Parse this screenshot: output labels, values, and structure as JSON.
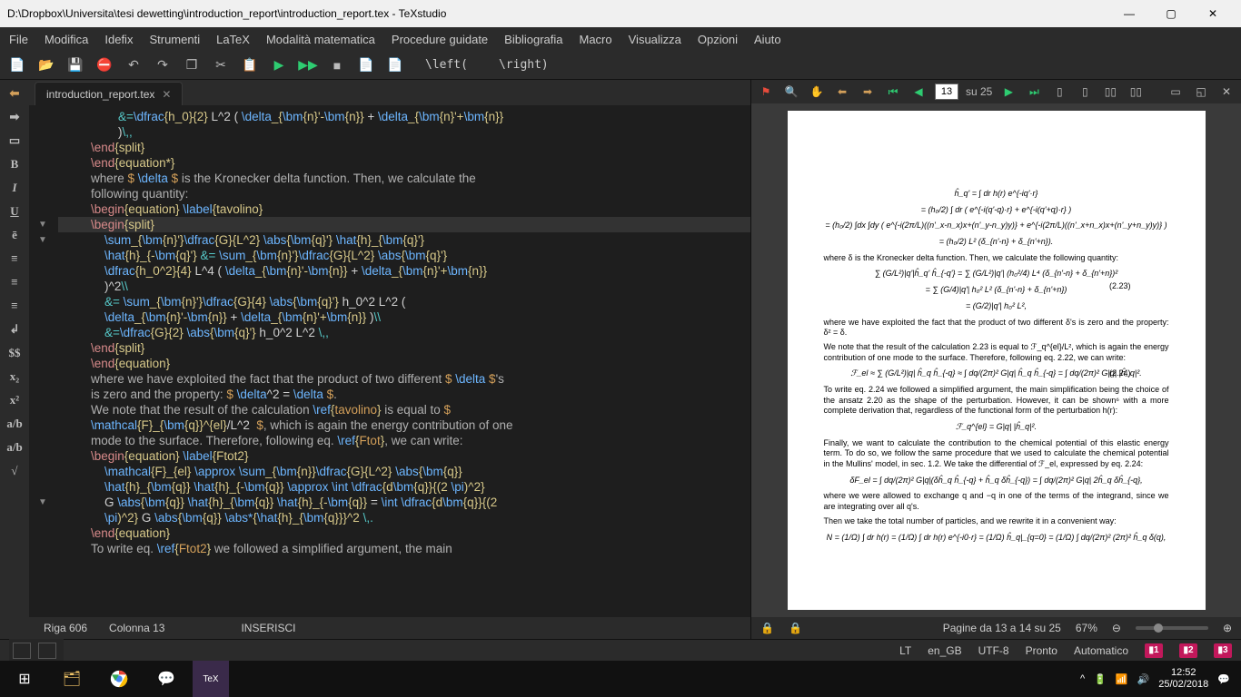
{
  "titlebar": {
    "title": "D:\\Dropbox\\Universita\\tesi dewetting\\introduction_report\\introduction_report.tex - TeXstudio"
  },
  "menubar": [
    "File",
    "Modifica",
    "Idefix",
    "Strumenti",
    "LaTeX",
    "Modalità matematica",
    "Procedure guidate",
    "Bibliografia",
    "Macro",
    "Visualizza",
    "Opzioni",
    "Aiuto"
  ],
  "brackets": {
    "left": "\\left(",
    "right": "\\right)"
  },
  "tab": {
    "name": "introduction_report.tex"
  },
  "editor": {
    "lines": [
      [
        [
          "c-cyan",
          "        &="
        ],
        [
          "c-blue",
          "\\dfrac"
        ],
        [
          "c-yellow",
          "{h_0}{2}"
        ],
        [
          "c-white",
          " L^2 ( "
        ],
        [
          "c-blue",
          "\\delta"
        ],
        [
          "c-yellow",
          "_{"
        ],
        [
          "c-blue",
          "\\bm"
        ],
        [
          "c-yellow",
          "{n}'-"
        ],
        [
          "c-blue",
          "\\bm"
        ],
        [
          "c-yellow",
          "{n}}"
        ],
        [
          "c-white",
          " + "
        ],
        [
          "c-blue",
          "\\delta"
        ],
        [
          "c-yellow",
          "_{"
        ],
        [
          "c-blue",
          "\\bm"
        ],
        [
          "c-yellow",
          "{n}'+"
        ],
        [
          "c-blue",
          "\\bm"
        ],
        [
          "c-yellow",
          "{n}}"
        ]
      ],
      [
        [
          "c-white",
          "        )"
        ],
        [
          "c-cyan",
          "\\,,"
        ]
      ],
      [
        [
          "c-redish",
          "\\end"
        ],
        [
          "c-yellow",
          "{split}"
        ]
      ],
      [
        [
          "c-redish",
          "\\end"
        ],
        [
          "c-yellow",
          "{equation*}"
        ]
      ],
      [
        [
          "c-plain",
          "where "
        ],
        [
          "c-orange",
          "$ "
        ],
        [
          "c-blue",
          "\\delta"
        ],
        [
          "c-orange",
          " $"
        ],
        [
          "c-plain",
          " is the Kronecker delta function. Then, we calculate the"
        ]
      ],
      [
        [
          "c-plain",
          "following quantity:"
        ]
      ],
      [
        [
          "c-plain",
          ""
        ]
      ],
      [
        [
          "c-redish",
          "\\begin"
        ],
        [
          "c-yellow",
          "{equation}"
        ],
        [
          "c-white",
          " "
        ],
        [
          "c-blue",
          "\\label"
        ],
        [
          "c-yellow",
          "{tavolino}"
        ]
      ],
      [
        [
          "c-redish",
          "\\begin"
        ],
        [
          "c-yellow",
          "{split}"
        ]
      ],
      [
        [
          "c-white",
          "    "
        ],
        [
          "c-blue",
          "\\sum"
        ],
        [
          "c-yellow",
          "_{"
        ],
        [
          "c-blue",
          "\\bm"
        ],
        [
          "c-yellow",
          "{n}'}"
        ],
        [
          "c-blue",
          "\\dfrac"
        ],
        [
          "c-yellow",
          "{G}{L^2}"
        ],
        [
          "c-white",
          " "
        ],
        [
          "c-blue",
          "\\abs"
        ],
        [
          "c-yellow",
          "{"
        ],
        [
          "c-blue",
          "\\bm"
        ],
        [
          "c-yellow",
          "{q}'}"
        ],
        [
          "c-white",
          " "
        ],
        [
          "c-blue",
          "\\hat"
        ],
        [
          "c-yellow",
          "{h}_{"
        ],
        [
          "c-blue",
          "\\bm"
        ],
        [
          "c-yellow",
          "{q}'}"
        ]
      ],
      [
        [
          "c-white",
          "    "
        ],
        [
          "c-blue",
          "\\hat"
        ],
        [
          "c-yellow",
          "{h}_{-"
        ],
        [
          "c-blue",
          "\\bm"
        ],
        [
          "c-yellow",
          "{q}'}"
        ],
        [
          "c-cyan",
          " &= "
        ],
        [
          "c-blue",
          "\\sum"
        ],
        [
          "c-yellow",
          "_{"
        ],
        [
          "c-blue",
          "\\bm"
        ],
        [
          "c-yellow",
          "{n}'}"
        ],
        [
          "c-blue",
          "\\dfrac"
        ],
        [
          "c-yellow",
          "{G}{L^2}"
        ],
        [
          "c-white",
          " "
        ],
        [
          "c-blue",
          "\\abs"
        ],
        [
          "c-yellow",
          "{"
        ],
        [
          "c-blue",
          "\\bm"
        ],
        [
          "c-yellow",
          "{q}'}"
        ]
      ],
      [
        [
          "c-white",
          "    "
        ],
        [
          "c-blue",
          "\\dfrac"
        ],
        [
          "c-yellow",
          "{h_0^2}{4}"
        ],
        [
          "c-white",
          " L^4 ( "
        ],
        [
          "c-blue",
          "\\delta"
        ],
        [
          "c-yellow",
          "_{"
        ],
        [
          "c-blue",
          "\\bm"
        ],
        [
          "c-yellow",
          "{n}'-"
        ],
        [
          "c-blue",
          "\\bm"
        ],
        [
          "c-yellow",
          "{n}}"
        ],
        [
          "c-white",
          " + "
        ],
        [
          "c-blue",
          "\\delta"
        ],
        [
          "c-yellow",
          "_{"
        ],
        [
          "c-blue",
          "\\bm"
        ],
        [
          "c-yellow",
          "{n}'+"
        ],
        [
          "c-blue",
          "\\bm"
        ],
        [
          "c-yellow",
          "{n}}"
        ]
      ],
      [
        [
          "c-white",
          "    )^2"
        ],
        [
          "c-cyan",
          "\\\\"
        ]
      ],
      [
        [
          "c-cyan",
          "    &= "
        ],
        [
          "c-blue",
          "\\sum"
        ],
        [
          "c-yellow",
          "_{"
        ],
        [
          "c-blue",
          "\\bm"
        ],
        [
          "c-yellow",
          "{n}'}"
        ],
        [
          "c-blue",
          "\\dfrac"
        ],
        [
          "c-yellow",
          "{G}{4}"
        ],
        [
          "c-white",
          " "
        ],
        [
          "c-blue",
          "\\abs"
        ],
        [
          "c-yellow",
          "{"
        ],
        [
          "c-blue",
          "\\bm"
        ],
        [
          "c-yellow",
          "{q}'}"
        ],
        [
          "c-white",
          " h_0^2 L^2 ("
        ]
      ],
      [
        [
          "c-white",
          "    "
        ],
        [
          "c-blue",
          "\\delta"
        ],
        [
          "c-yellow",
          "_{"
        ],
        [
          "c-blue",
          "\\bm"
        ],
        [
          "c-yellow",
          "{n}'-"
        ],
        [
          "c-blue",
          "\\bm"
        ],
        [
          "c-yellow",
          "{n}}"
        ],
        [
          "c-white",
          " + "
        ],
        [
          "c-blue",
          "\\delta"
        ],
        [
          "c-yellow",
          "_{"
        ],
        [
          "c-blue",
          "\\bm"
        ],
        [
          "c-yellow",
          "{n}'+"
        ],
        [
          "c-blue",
          "\\bm"
        ],
        [
          "c-yellow",
          "{n}}"
        ],
        [
          "c-white",
          " )"
        ],
        [
          "c-cyan",
          "\\\\"
        ]
      ],
      [
        [
          "c-cyan",
          "    &="
        ],
        [
          "c-blue",
          "\\dfrac"
        ],
        [
          "c-yellow",
          "{G}{2}"
        ],
        [
          "c-white",
          " "
        ],
        [
          "c-blue",
          "\\abs"
        ],
        [
          "c-yellow",
          "{"
        ],
        [
          "c-blue",
          "\\bm"
        ],
        [
          "c-yellow",
          "{q}'}"
        ],
        [
          "c-white",
          " h_0^2 L^2 "
        ],
        [
          "c-cyan",
          "\\,,"
        ]
      ],
      [
        [
          "c-redish",
          "\\end"
        ],
        [
          "c-yellow",
          "{split}"
        ]
      ],
      [
        [
          "c-redish",
          "\\end"
        ],
        [
          "c-yellow",
          "{equation}"
        ]
      ],
      [
        [
          "c-plain",
          "where we have exploited the fact that the product of two different "
        ],
        [
          "c-orange",
          "$ "
        ],
        [
          "c-blue",
          "\\delta"
        ],
        [
          "c-orange",
          " $"
        ],
        [
          "c-plain",
          "'s"
        ]
      ],
      [
        [
          "c-plain",
          "is zero and the property: "
        ],
        [
          "c-orange",
          "$ "
        ],
        [
          "c-blue",
          "\\delta"
        ],
        [
          "c-white",
          "^2 = "
        ],
        [
          "c-blue",
          "\\delta"
        ],
        [
          "c-orange",
          " $"
        ],
        [
          "c-plain",
          "."
        ]
      ],
      [
        [
          "c-plain",
          ""
        ]
      ],
      [
        [
          "c-plain",
          "We note that the result of the calculation "
        ],
        [
          "c-blue",
          "\\ref"
        ],
        [
          "c-yellow",
          "{"
        ],
        [
          "c-orange",
          "tavolino"
        ],
        [
          "c-yellow",
          "}"
        ],
        [
          "c-plain",
          " is equal to "
        ],
        [
          "c-orange",
          "$"
        ]
      ],
      [
        [
          "c-blue",
          "\\mathcal"
        ],
        [
          "c-yellow",
          "{F}_{"
        ],
        [
          "c-blue",
          "\\bm"
        ],
        [
          "c-yellow",
          "{q}}^{el}"
        ],
        [
          "c-white",
          "/L^2  "
        ],
        [
          "c-orange",
          "$"
        ],
        [
          "c-plain",
          ", which is again the energy contribution of one"
        ]
      ],
      [
        [
          "c-plain",
          "mode to the surface. Therefore, following eq. "
        ],
        [
          "c-blue",
          "\\ref"
        ],
        [
          "c-yellow",
          "{"
        ],
        [
          "c-orange",
          "Ftot"
        ],
        [
          "c-yellow",
          "}"
        ],
        [
          "c-plain",
          ", we can write:"
        ]
      ],
      [
        [
          "c-plain",
          ""
        ]
      ],
      [
        [
          "c-redish",
          "\\begin"
        ],
        [
          "c-yellow",
          "{equation}"
        ],
        [
          "c-white",
          " "
        ],
        [
          "c-blue",
          "\\label"
        ],
        [
          "c-yellow",
          "{Ftot2}"
        ]
      ],
      [
        [
          "c-white",
          "    "
        ],
        [
          "c-blue",
          "\\mathcal"
        ],
        [
          "c-yellow",
          "{F}_{el}"
        ],
        [
          "c-white",
          " "
        ],
        [
          "c-blue",
          "\\approx"
        ],
        [
          "c-white",
          " "
        ],
        [
          "c-blue",
          "\\sum"
        ],
        [
          "c-yellow",
          "_{"
        ],
        [
          "c-blue",
          "\\bm"
        ],
        [
          "c-yellow",
          "{n}}"
        ],
        [
          "c-blue",
          "\\dfrac"
        ],
        [
          "c-yellow",
          "{G}{L^2}"
        ],
        [
          "c-white",
          " "
        ],
        [
          "c-blue",
          "\\abs"
        ],
        [
          "c-yellow",
          "{"
        ],
        [
          "c-blue",
          "\\bm"
        ],
        [
          "c-yellow",
          "{q}}"
        ]
      ],
      [
        [
          "c-white",
          "    "
        ],
        [
          "c-blue",
          "\\hat"
        ],
        [
          "c-yellow",
          "{h}_{"
        ],
        [
          "c-blue",
          "\\bm"
        ],
        [
          "c-yellow",
          "{q}}"
        ],
        [
          "c-white",
          " "
        ],
        [
          "c-blue",
          "\\hat"
        ],
        [
          "c-yellow",
          "{h}_{-"
        ],
        [
          "c-blue",
          "\\bm"
        ],
        [
          "c-yellow",
          "{q}}"
        ],
        [
          "c-white",
          " "
        ],
        [
          "c-blue",
          "\\approx"
        ],
        [
          "c-white",
          " "
        ],
        [
          "c-blue",
          "\\int"
        ],
        [
          "c-white",
          " "
        ],
        [
          "c-blue",
          "\\dfrac"
        ],
        [
          "c-yellow",
          "{d"
        ],
        [
          "c-blue",
          "\\bm"
        ],
        [
          "c-yellow",
          "{q}}{(2 "
        ],
        [
          "c-blue",
          "\\pi"
        ],
        [
          "c-yellow",
          ")^2}"
        ]
      ],
      [
        [
          "c-white",
          "    G "
        ],
        [
          "c-blue",
          "\\abs"
        ],
        [
          "c-yellow",
          "{"
        ],
        [
          "c-blue",
          "\\bm"
        ],
        [
          "c-yellow",
          "{q}}"
        ],
        [
          "c-white",
          " "
        ],
        [
          "c-blue",
          "\\hat"
        ],
        [
          "c-yellow",
          "{h}_{"
        ],
        [
          "c-blue",
          "\\bm"
        ],
        [
          "c-yellow",
          "{q}}"
        ],
        [
          "c-white",
          " "
        ],
        [
          "c-blue",
          "\\hat"
        ],
        [
          "c-yellow",
          "{h}_{-"
        ],
        [
          "c-blue",
          "\\bm"
        ],
        [
          "c-yellow",
          "{q}}"
        ],
        [
          "c-white",
          " = "
        ],
        [
          "c-blue",
          "\\int"
        ],
        [
          "c-white",
          " "
        ],
        [
          "c-blue",
          "\\dfrac"
        ],
        [
          "c-yellow",
          "{d"
        ],
        [
          "c-blue",
          "\\bm"
        ],
        [
          "c-yellow",
          "{q}}{(2"
        ]
      ],
      [
        [
          "c-white",
          "    "
        ],
        [
          "c-blue",
          "\\pi"
        ],
        [
          "c-yellow",
          ")^2}"
        ],
        [
          "c-white",
          " G "
        ],
        [
          "c-blue",
          "\\abs"
        ],
        [
          "c-yellow",
          "{"
        ],
        [
          "c-blue",
          "\\bm"
        ],
        [
          "c-yellow",
          "{q}}"
        ],
        [
          "c-white",
          " "
        ],
        [
          "c-blue",
          "\\abs*"
        ],
        [
          "c-yellow",
          "{"
        ],
        [
          "c-blue",
          "\\hat"
        ],
        [
          "c-yellow",
          "{h}_{"
        ],
        [
          "c-blue",
          "\\bm"
        ],
        [
          "c-yellow",
          "{q}}}^2"
        ],
        [
          "c-white",
          " "
        ],
        [
          "c-cyan",
          "\\,."
        ]
      ],
      [
        [
          "c-redish",
          "\\end"
        ],
        [
          "c-yellow",
          "{equation}"
        ]
      ],
      [
        [
          "c-plain",
          ""
        ]
      ],
      [
        [
          "c-plain",
          "To write eq. "
        ],
        [
          "c-blue",
          "\\ref"
        ],
        [
          "c-yellow",
          "{"
        ],
        [
          "c-orange",
          "Ftot2"
        ],
        [
          "c-yellow",
          "}"
        ],
        [
          "c-plain",
          " we followed a simplified argument, the main"
        ]
      ]
    ],
    "highlight_index": 8,
    "folds": [
      7,
      8,
      25
    ]
  },
  "statusbar": {
    "row": "Riga 606",
    "col": "Colonna 13",
    "mode": "INSERISCI"
  },
  "pdf": {
    "page_input": "13",
    "page_total": "su 25",
    "status": "Pagine da 13 a 14 su 25",
    "zoom": "67%",
    "body": {
      "p1": "where δ is the Kronecker delta function. Then, we calculate the following quantity:",
      "eq1": "∑ (G/L²)|q'|ĥ_q' ĥ_{-q'} = ∑ (G/L²)|q'| (h₀²/4) L⁴ (δ_{n'-n} + δ_{n'+n})²",
      "eq1b": "= ∑ (G/4)|q'| h₀² L² (δ_{n'-n} + δ_{n'+n})",
      "eq1c": "= (G/2)|q'| h₀² L²,",
      "eq1num": "(2.23)",
      "p2": "where we have exploited the fact that the product of two different δ's is zero and the property: δ² = δ.",
      "p3": "We note that the result of the calculation 2.23 is equal to ℱ_q^{el}/L², which is again the energy contribution of one mode to the surface. Therefore, following eq. 2.22, we can write:",
      "eq2": "ℱ_el ≈ ∑ (G/L²)|q| ĥ_q ĥ_{-q} ≈ ∫ dq/(2π)² G|q| ĥ_q ĥ_{-q} = ∫ dq/(2π)² G|q| |ĥ_q|².",
      "eq2num": "(2.24)",
      "p4": "To write eq. 2.24 we followed a simplified argument, the main simplification being the choice of the ansatz 2.20 as the shape of the perturbation. However, it can be shown⁶ with a more complete derivation that, regardless of the functional form of the perturbation h(r):",
      "eq3": "ℱ_q^{el} = G|q| |ĥ_q|².",
      "p5": "Finally, we want to calculate the contribution to the chemical potential of this elastic energy term. To do so, we follow the same procedure that we used to calculate the chemical potential in the Mullins' model, in sec. 1.2. We take the differential of ℱ_el, expressed by eq. 2.24:",
      "eq4": "δF_el = ∫ dq/(2π)² G|q|(δĥ_q ĥ_{-q} + ĥ_q δĥ_{-q}) = ∫ dq/(2π)² G|q| 2ĥ_q δĥ_{-q},",
      "p6": "where we were allowed to exchange q and −q in one of the terms of the integrand, since we are integrating over all q's.",
      "p7": "Then we take the total number of particles, and we rewrite it in a convenient way:",
      "eq5": "N = (1/Ω) ∫ dr h(r) = (1/Ω) ∫ dr h(r) e^{-i0·r} = (1/Ω) ĥ_q|_{q=0} = (1/Ω) ∫ dq/(2π)² (2π)² ĥ_q δ(q),",
      "eq0a": "ĥ_q' = ∫ dr h(r) e^{-iq'·r}",
      "eq0b": "= (h₀/2) ∫ dr ( e^{-i(q'-q)·r} + e^{-i(q'+q)·r} )",
      "eq0c": "= (h₀/2) ∫dx ∫dy ( e^{-i(2π/L)((n'_x-n_x)x+(n'_y-n_y)y)} + e^{-i(2π/L)((n'_x+n_x)x+(n'_y+n_y)y)} )",
      "eq0d": "= (h₀/2) L² (δ_{n'-n} + δ_{n'+n})."
    }
  },
  "bottom": {
    "lang": "en_GB",
    "enc": "UTF-8",
    "ready": "Pronto",
    "auto": "Automatico",
    "lt": "LT"
  },
  "tray": {
    "time": "12:52",
    "date": "25/02/2018"
  }
}
